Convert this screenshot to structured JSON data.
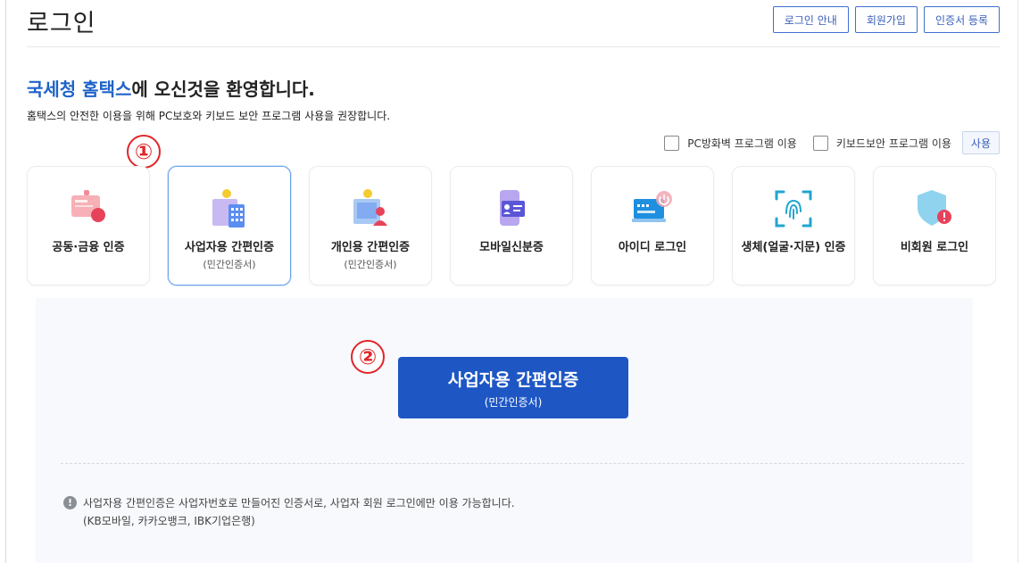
{
  "page_title": "로그인",
  "top_buttons": [
    "로그인 안내",
    "회원가입",
    "인증서 등록"
  ],
  "welcome": {
    "accent": "국세청 홈택스",
    "rest": "에 오신것을 환영합니다."
  },
  "subtext": "홈택스의 안전한 이용을 위해 PC보호와 키보드 보안 프로그램 사용을 권장합니다.",
  "options": {
    "firewall": "PC방화벽 프로그램 이용",
    "keyboard": "키보드보안 프로그램 이용",
    "use_button": "사용"
  },
  "markers": [
    "①",
    "②"
  ],
  "cards": [
    {
      "label": "공동·금융 인증",
      "sub": "",
      "icon": "certificate-icon"
    },
    {
      "label": "사업자용 간편인증",
      "sub": "(민간인증서)",
      "icon": "business-auth-icon"
    },
    {
      "label": "개인용 간편인증",
      "sub": "(민간인증서)",
      "icon": "personal-auth-icon"
    },
    {
      "label": "모바일신분증",
      "sub": "",
      "icon": "mobile-id-icon"
    },
    {
      "label": "아이디 로그인",
      "sub": "",
      "icon": "id-login-icon"
    },
    {
      "label": "생체(얼굴·지문) 인증",
      "sub": "",
      "icon": "fingerprint-icon"
    },
    {
      "label": "비회원 로그인",
      "sub": "",
      "icon": "shield-icon"
    }
  ],
  "main_button": {
    "title": "사업자용 간편인증",
    "sub": "(민간인증서)"
  },
  "info": {
    "line1": "사업자용 간편인증은 사업자번호로 만들어진 인증서로, 사업자 회원 로그인에만 이용 가능합니다.",
    "line2": "(KB모바일, 카카오뱅크, IBK기업은행)"
  },
  "colors": {
    "accent": "#1f63c9",
    "primary_button": "#1e57c4",
    "marker": "#e0262a",
    "panel_bg": "#f7f9fc"
  }
}
